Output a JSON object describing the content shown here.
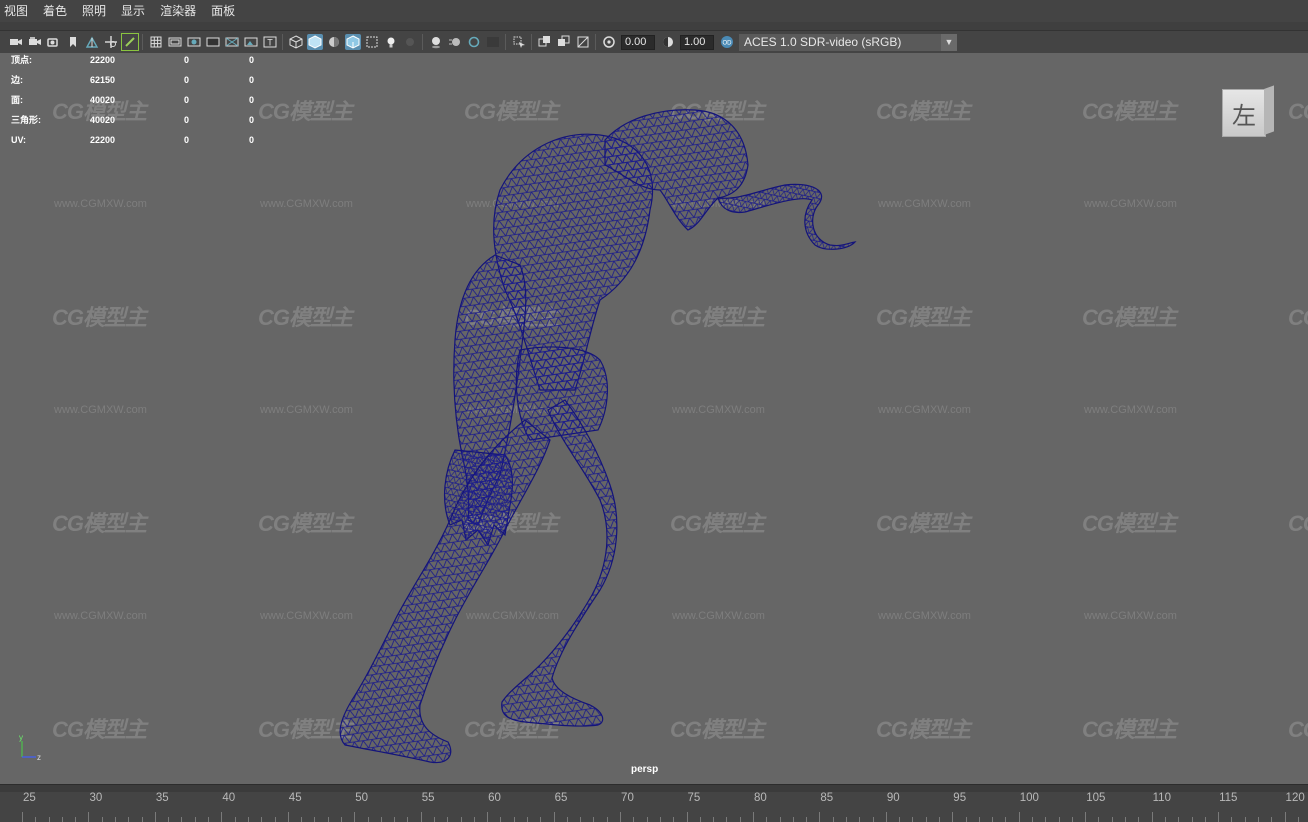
{
  "menu": [
    "视图",
    "着色",
    "照明",
    "显示",
    "渲染器",
    "面板"
  ],
  "toolbar": {
    "exposure_value": "0.00",
    "gamma_value": "1.00",
    "color_space": "ACES 1.0 SDR-video (sRGB)",
    "icons": [
      "camera-icon",
      "camera-attributes-icon",
      "bookmark-camera-icon",
      "bookmark-icon",
      "image-plane-icon",
      "2d-pan-zoom-icon",
      "grease-pencil-icon",
      "grid-icon",
      "film-gate-icon",
      "resolution-gate-icon",
      "gate-mask-icon",
      "field-chart-icon",
      "safe-action-icon",
      "safe-title-icon",
      "wireframe-icon",
      "smooth-shade-icon",
      "use-default-material-icon",
      "wireframe-on-shaded-icon",
      "xray-icon",
      "use-all-lights-icon",
      "shadows-icon",
      "screen-space-ao-icon",
      "motion-blur-icon",
      "multisample-aa-icon",
      "depth-of-field-icon",
      "isolate-select-icon",
      "xray-joints-icon",
      "xray-active-icon",
      "backface-culling-icon",
      "exposure-icon",
      "gamma-icon",
      "color-management-icon"
    ]
  },
  "hud": {
    "rows": [
      {
        "label": "顶点:",
        "v1": "22200",
        "v2": "0",
        "v3": "0"
      },
      {
        "label": "边:",
        "v1": "62150",
        "v2": "0",
        "v3": "0"
      },
      {
        "label": "面:",
        "v1": "40020",
        "v2": "0",
        "v3": "0"
      },
      {
        "label": "三角形:",
        "v1": "40020",
        "v2": "0",
        "v3": "0"
      },
      {
        "label": "UV:",
        "v1": "22200",
        "v2": "0",
        "v3": "0"
      }
    ]
  },
  "viewcube_label": "左",
  "camera_label": "persp",
  "axis": {
    "y": "y",
    "z": "z"
  },
  "watermark": {
    "logo": "CG模型主",
    "url": "www.CGMXW.com"
  },
  "timeline": [
    "25",
    "30",
    "35",
    "40",
    "45",
    "50",
    "55",
    "60",
    "65",
    "70",
    "75",
    "80",
    "85",
    "90",
    "95",
    "100",
    "105",
    "110",
    "115",
    "120"
  ],
  "colors": {
    "wireframe": "#1a1a8c",
    "viewport_bg": "#666666",
    "ui_bg": "#444444",
    "active_icon": "#5a8fb0"
  }
}
